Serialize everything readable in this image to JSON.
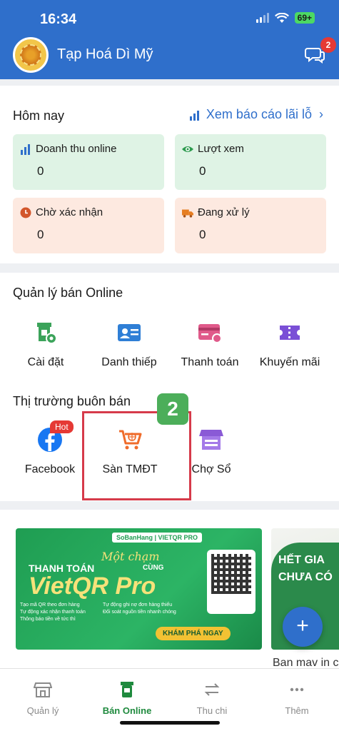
{
  "status_bar": {
    "time": "16:34",
    "battery": "69+"
  },
  "header": {
    "shop_name": "Tạp Hoá Dì Mỹ",
    "chat_badge": "2"
  },
  "today": {
    "title": "Hôm nay",
    "report_link": "Xem báo cáo lãi lỗ",
    "stats": [
      {
        "label": "Doanh thu online",
        "value": "0",
        "color": "#dff3e5"
      },
      {
        "label": "Lượt xem",
        "value": "0",
        "color": "#dff3e5"
      },
      {
        "label": "Chờ xác nhận",
        "value": "0",
        "color": "#fde9e0"
      },
      {
        "label": "Đang xử lý",
        "value": "0",
        "color": "#fde9e0"
      }
    ]
  },
  "online_management": {
    "title": "Quản lý bán Online",
    "tools": [
      {
        "label": "Cài đặt",
        "icon": "store-settings-icon"
      },
      {
        "label": "Danh thiếp",
        "icon": "business-card-icon"
      },
      {
        "label": "Thanh toán",
        "icon": "payment-card-icon"
      },
      {
        "label": "Khuyến mãi",
        "icon": "voucher-icon"
      }
    ]
  },
  "marketplace": {
    "title": "Thị trường buôn bán",
    "hot_badge": "Hot",
    "step_badge": "2",
    "items": [
      {
        "label": "Facebook",
        "icon": "facebook-icon"
      },
      {
        "label": "Sàn TMĐT",
        "icon": "shopping-cart-icon"
      },
      {
        "label": "Chợ Sổ",
        "icon": "market-stall-icon"
      }
    ]
  },
  "banner": {
    "header": "SoBanHang | VIETQR PRO",
    "title_line1": "THANH TOÁN",
    "script": "Một chạm",
    "cung": "CÙNG",
    "brand": "VietQR Pro",
    "features": [
      "Tạo mã QR theo đơn hàng",
      "Tự động xác nhận thanh toán",
      "Thông báo tiền về tức thì",
      "Tự động ghi nợ đơn hàng thiếu",
      "Đối soát nguồn tiền nhanh chóng"
    ],
    "cta": "KHÁM PHÁ NGAY"
  },
  "banner2": {
    "line1": "HẾT GIA",
    "line2": "CHƯA CÓ",
    "caption": "Ban mav in c"
  },
  "bottom_nav": [
    {
      "label": "Quản lý",
      "icon": "store-icon"
    },
    {
      "label": "Bán Online",
      "icon": "online-store-icon"
    },
    {
      "label": "Thu chi",
      "icon": "transfer-icon"
    },
    {
      "label": "Thêm",
      "icon": "more-icon"
    }
  ]
}
